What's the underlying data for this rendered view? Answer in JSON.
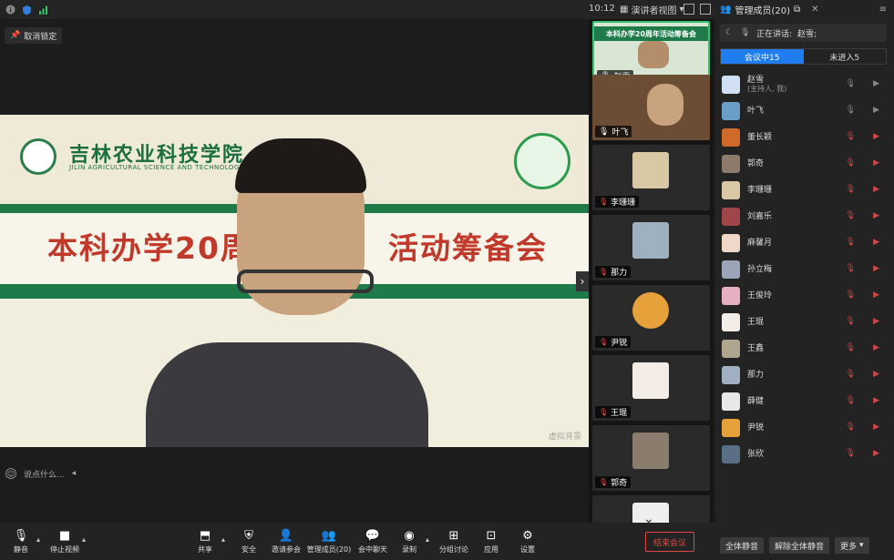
{
  "topbar": {
    "time": "10:12",
    "view_mode": "演讲者视图"
  },
  "stage": {
    "unlock_label": "取消锁定",
    "slide": {
      "school_cn": "吉林农业科技学院",
      "school_en": "JILIN AGRICULTURAL SCIENCE AND TECHNOLOGY UNIVERSITY",
      "title": "本科办学20周",
      "title_tail": "活动筹备会"
    },
    "watermark": "虚拟背景",
    "chat_placeholder": "说点什么..."
  },
  "video_tiles": [
    {
      "name": "赵雪",
      "thumb_text": "本科办学20周年活动筹备会"
    },
    {
      "name": "叶飞"
    },
    {
      "name": "李珊珊"
    },
    {
      "name": "那力"
    },
    {
      "name": "尹锐"
    },
    {
      "name": "王琨"
    },
    {
      "name": "郭奇"
    }
  ],
  "panel": {
    "title": "管理成员(20)",
    "speaking_label": "正在讲话:",
    "speaking_name": "赵雪;",
    "tabs": [
      {
        "label": "会议中15"
      },
      {
        "label": "未进入5"
      }
    ],
    "participants": [
      {
        "name": "赵雪",
        "sub": "(主持人, 我)",
        "muted": false
      },
      {
        "name": "叶飞",
        "sub": "",
        "muted": false
      },
      {
        "name": "董长颖",
        "sub": "",
        "muted": true
      },
      {
        "name": "郭奇",
        "sub": "",
        "muted": true
      },
      {
        "name": "李珊珊",
        "sub": "",
        "muted": true
      },
      {
        "name": "刘嘉乐",
        "sub": "",
        "muted": true
      },
      {
        "name": "麻馨月",
        "sub": "",
        "muted": true
      },
      {
        "name": "孙立梅",
        "sub": "",
        "muted": true
      },
      {
        "name": "王俊玲",
        "sub": "",
        "muted": true
      },
      {
        "name": "王琨",
        "sub": "",
        "muted": true
      },
      {
        "name": "王鑫",
        "sub": "",
        "muted": true
      },
      {
        "name": "那力",
        "sub": "",
        "muted": true
      },
      {
        "name": "薛健",
        "sub": "",
        "muted": true
      },
      {
        "name": "尹锐",
        "sub": "",
        "muted": true
      },
      {
        "name": "张欣",
        "sub": "",
        "muted": true
      }
    ],
    "footer": {
      "mute_all": "全体静音",
      "unmute_all": "解除全体静音",
      "more": "更多"
    }
  },
  "toolbar": {
    "mute": "静音",
    "stop_video": "停止视频",
    "share": "共享",
    "security": "安全",
    "invite": "邀请参会",
    "manage": "管理成员(20)",
    "chat": "会中聊天",
    "record": "录制",
    "breakout": "分组讨论",
    "apps": "应用",
    "settings": "设置",
    "end": "结束会议"
  },
  "colors": {
    "accent": "#1f7df0",
    "end_red": "#e34848",
    "active_green": "#32c36c",
    "slide_green": "#1f7a4a",
    "slide_title_red": "#c0392b"
  }
}
